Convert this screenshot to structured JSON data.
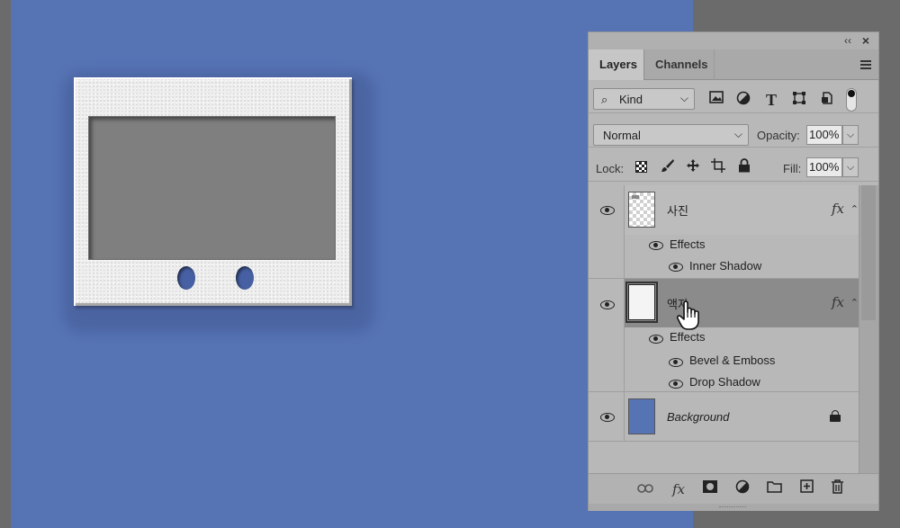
{
  "panel": {
    "tabs": [
      {
        "label": "Layers",
        "active": true
      },
      {
        "label": "Channels",
        "active": false
      }
    ]
  },
  "filter": {
    "kind_label": "Kind",
    "icons": [
      "image-filter-icon",
      "adjustment-filter-icon",
      "type-filter-icon",
      "shape-filter-icon",
      "smart-object-filter-icon"
    ]
  },
  "blend": {
    "mode": "Normal",
    "opacity_label": "Opacity:",
    "opacity_value": "100%"
  },
  "lock": {
    "label": "Lock:",
    "fill_label": "Fill:",
    "fill_value": "100%"
  },
  "layers": [
    {
      "name": "사진",
      "fx": "fx",
      "effects_label": "Effects",
      "effects": [
        "Inner Shadow"
      ]
    },
    {
      "name": "액자",
      "fx": "fx",
      "selected": true,
      "effects_label": "Effects",
      "effects": [
        "Bevel & Emboss",
        "Drop Shadow"
      ]
    },
    {
      "name": "Background",
      "locked": true
    }
  ],
  "colors": {
    "canvas": "#5673b4",
    "frame": "#eeeeee",
    "photo": "#7f7f7f",
    "panel": "#b8b8b8",
    "selected_layer": "#8b8b8b"
  }
}
